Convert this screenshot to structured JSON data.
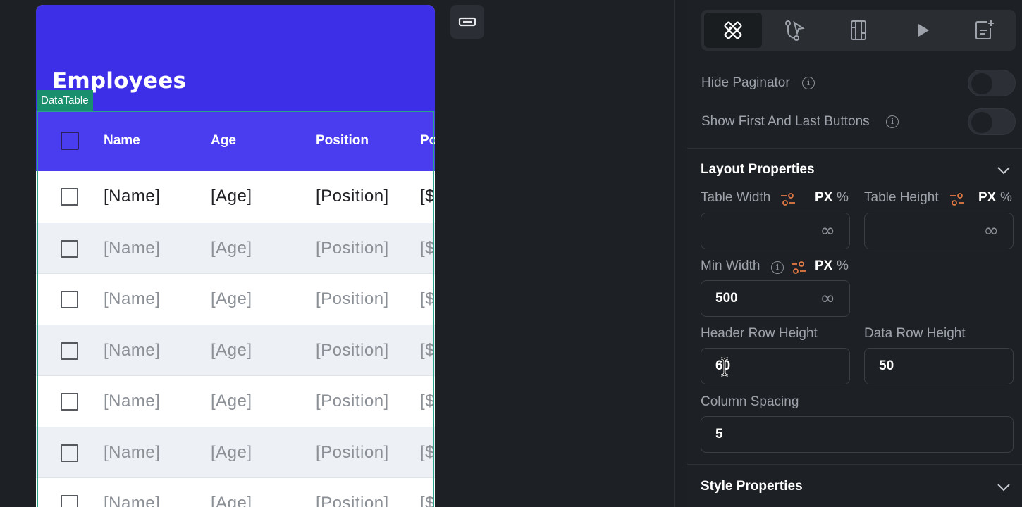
{
  "canvas": {
    "app_title": "Employees",
    "component_badge": "DataTable",
    "table": {
      "columns": [
        "Name",
        "Age",
        "Position",
        "Po"
      ],
      "rows": [
        {
          "name": "[Name]",
          "age": "[Age]",
          "position": "[Position]",
          "extra": "[$"
        },
        {
          "name": "[Name]",
          "age": "[Age]",
          "position": "[Position]",
          "extra": "[$"
        },
        {
          "name": "[Name]",
          "age": "[Age]",
          "position": "[Position]",
          "extra": "[$"
        },
        {
          "name": "[Name]",
          "age": "[Age]",
          "position": "[Position]",
          "extra": "[$"
        },
        {
          "name": "[Name]",
          "age": "[Age]",
          "position": "[Position]",
          "extra": "[$"
        },
        {
          "name": "[Name]",
          "age": "[Age]",
          "position": "[Position]",
          "extra": "[$"
        },
        {
          "name": "[Name]",
          "age": "[Age]",
          "position": "[Position]",
          "extra": "[$"
        }
      ]
    }
  },
  "panel": {
    "tabs": [
      {
        "icon": "properties-tool-icon",
        "active": true
      },
      {
        "icon": "actions-flow-icon",
        "active": false
      },
      {
        "icon": "widget-tree-icon",
        "active": false
      },
      {
        "icon": "play-icon",
        "active": false
      },
      {
        "icon": "add-note-icon",
        "active": false
      }
    ],
    "hide_paginator": {
      "label": "Hide Paginator",
      "on": false
    },
    "show_first_last": {
      "label": "Show First And Last Buttons",
      "on": false
    },
    "layout": {
      "title": "Layout Properties",
      "table_width": {
        "label": "Table Width",
        "value": "",
        "unit_px": "PX",
        "unit_pct": "%"
      },
      "table_height": {
        "label": "Table Height",
        "value": "",
        "unit_px": "PX",
        "unit_pct": "%"
      },
      "min_width": {
        "label": "Min Width",
        "value": "500",
        "unit_px": "PX",
        "unit_pct": "%"
      },
      "infinity_symbol": "∞",
      "header_row_height": {
        "label": "Header Row Height",
        "value": "60"
      },
      "data_row_height": {
        "label": "Data Row Height",
        "value": "50"
      },
      "column_spacing": {
        "label": "Column Spacing",
        "value": "5"
      }
    },
    "style": {
      "title": "Style Properties"
    }
  },
  "colors": {
    "appbar": "#3d2ee8",
    "header": "#4a3df0",
    "badge": "#1a8f6e",
    "accent_orange": "#e07a45"
  }
}
